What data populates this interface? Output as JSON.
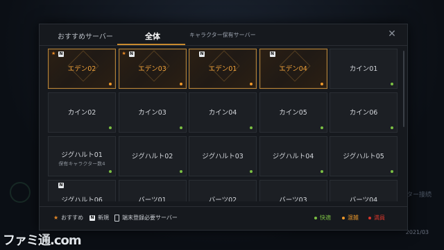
{
  "tabs": {
    "recommended": "おすすめサーバー",
    "all": "全体",
    "owned": "キャラクター保有サーバー"
  },
  "close_icon": "✕",
  "colors": {
    "fast": "#7bc043",
    "busy": "#f09a2a",
    "full": "#d9362b",
    "accent": "#c88a2f"
  },
  "servers": [
    {
      "name": "エデン02",
      "featured": true,
      "star": true,
      "new": true,
      "status": "busy"
    },
    {
      "name": "エデン03",
      "featured": true,
      "star": true,
      "new": true,
      "status": "busy"
    },
    {
      "name": "エデン01",
      "featured": true,
      "star": false,
      "new": true,
      "status": "busy"
    },
    {
      "name": "エデン04",
      "featured": true,
      "star": false,
      "new": true,
      "status": "busy"
    },
    {
      "name": "カイン01",
      "featured": false,
      "status": "fast"
    },
    {
      "name": "カイン02",
      "featured": false,
      "status": "fast"
    },
    {
      "name": "カイン03",
      "featured": false,
      "status": "fast"
    },
    {
      "name": "カイン04",
      "featured": false,
      "status": "fast"
    },
    {
      "name": "カイン05",
      "featured": false,
      "status": "fast"
    },
    {
      "name": "カイン06",
      "featured": false,
      "status": "fast"
    },
    {
      "name": "ジグハルト01",
      "featured": false,
      "sub": "保有キャラクター数4",
      "status": "fast"
    },
    {
      "name": "ジグハルト02",
      "featured": false,
      "status": "fast"
    },
    {
      "name": "ジグハルト03",
      "featured": false,
      "status": "fast"
    },
    {
      "name": "ジグハルト04",
      "featured": false,
      "status": "fast"
    },
    {
      "name": "ジグハルト05",
      "featured": false,
      "status": "fast"
    },
    {
      "name": "ジグハルト06",
      "featured": false,
      "new": true,
      "status": "fast"
    },
    {
      "name": "バーツ01",
      "featured": false,
      "status": "fast"
    },
    {
      "name": "バーツ02",
      "featured": false,
      "status": "fast"
    },
    {
      "name": "バーツ03",
      "featured": false,
      "status": "fast"
    },
    {
      "name": "バーツ04",
      "featured": false,
      "status": "fast"
    }
  ],
  "legend": {
    "recommended": "おすすめ",
    "new": "新規",
    "new_badge": "N",
    "star_icon": "★",
    "device": "端末登録必要サーバー",
    "fast": "快適",
    "busy": "混雑",
    "full": "満員"
  },
  "background": {
    "right_text": "ター接続",
    "date": "2021/03",
    "watermark": "ファミ通.com"
  }
}
